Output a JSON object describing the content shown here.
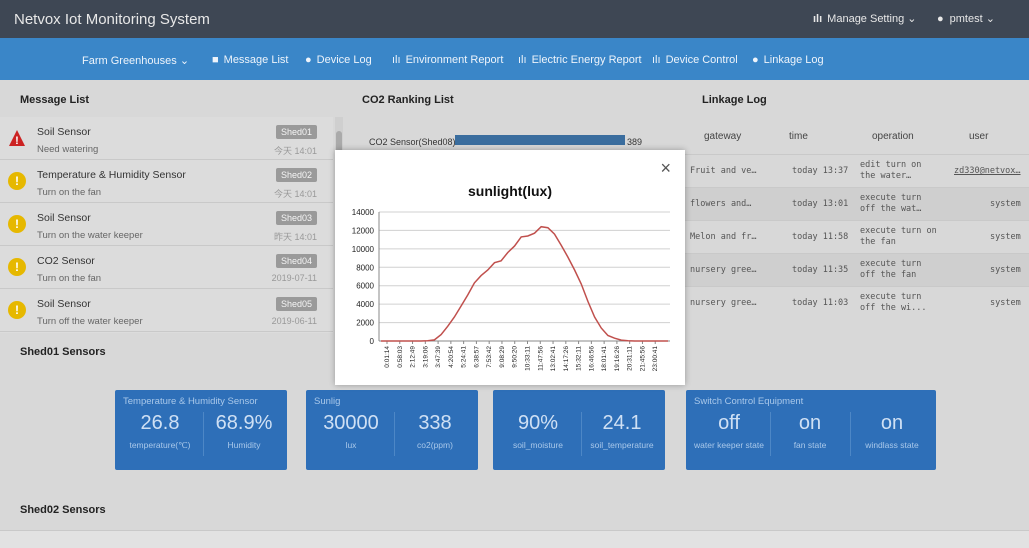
{
  "header": {
    "app_title": "Netvox Iot Monitoring System",
    "manage_setting": "Manage Setting ⌄",
    "user": "pmtest ⌄"
  },
  "nav": {
    "farm": "Farm Greenhouses ⌄",
    "message_list": "Message List",
    "device_log": "Device Log",
    "environment_report": "Environment Report",
    "electric_energy_report": "Electric Energy Report",
    "device_control": "Device Control",
    "linkage_log": "Linkage Log"
  },
  "panels": {
    "message_list": "Message List",
    "co2_ranking": "CO2 Ranking List",
    "linkage_log": "Linkage Log"
  },
  "messages": [
    {
      "title": "Soil Sensor",
      "sub": "Need watering",
      "shed": "Shed01",
      "date": "今天 14:01",
      "badge": "red"
    },
    {
      "title": "Temperature & Humidity Sensor",
      "sub": "Turn on the fan",
      "shed": "Shed02",
      "date": "今天 14:01",
      "badge": "yellow"
    },
    {
      "title": "Soil Sensor",
      "sub": "Turn on the water keeper",
      "shed": "Shed03",
      "date": "昨天 14:01",
      "badge": "yellow"
    },
    {
      "title": "CO2 Sensor",
      "sub": "Turn on the fan",
      "shed": "Shed04",
      "date": "2019-07-11",
      "badge": "yellow"
    },
    {
      "title": "Soil Sensor",
      "sub": "Turn off the water keeper",
      "shed": "Shed05",
      "date": "2019-06-11",
      "badge": "yellow"
    }
  ],
  "ranking": {
    "label": "CO2 Sensor(Shed08)",
    "value": "389"
  },
  "linkage": {
    "headers": [
      "gateway",
      "time",
      "operation",
      "user"
    ],
    "rows": [
      {
        "gateway": "Fruit and ve…",
        "time": "today 13:37",
        "op1": "edit turn on",
        "op2": "the water…",
        "user": "zd330@netvox…"
      },
      {
        "gateway": "flowers and…",
        "time": "today 13:01",
        "op1": "execute turn",
        "op2": "off the wat…",
        "user": "system"
      },
      {
        "gateway": "Melon and fr…",
        "time": "today 11:58",
        "op1": "execute turn on",
        "op2": "the fan",
        "user": "system"
      },
      {
        "gateway": "nursery gree…",
        "time": "today 11:35",
        "op1": "execute turn",
        "op2": "off the fan",
        "user": "system"
      },
      {
        "gateway": "nursery gree…",
        "time": "today 11:03",
        "op1": "execute turn",
        "op2": "off the wi...",
        "user": "system"
      }
    ]
  },
  "sections": {
    "shed01": "Shed01 Sensors",
    "shed02": "Shed02 Sensors"
  },
  "cards": {
    "th": {
      "title": "Temperature & Humidity Sensor",
      "v1": "26.8",
      "s1": "temperature(℃)",
      "v2": "68.9%",
      "s2": "Humidity"
    },
    "sun": {
      "title": "Sunlig",
      "v1": "30000",
      "s1": "lux",
      "v2": "338",
      "s2": "co2(ppm)"
    },
    "soil": {
      "v1": "90%",
      "s1": "soil_moisture",
      "v2": "24.1",
      "s2": "soil_temperature"
    },
    "switch": {
      "title": "Switch Control Equipment",
      "v1": "off",
      "s1": "water keeper state",
      "v2": "on",
      "s2": "fan state",
      "v3": "on",
      "s3": "windlass state"
    }
  },
  "modal": {
    "close": "×"
  },
  "colors": {
    "topbar": "#3e4754",
    "navbar": "#3a86c8",
    "card": "#2e6fb8",
    "line": "#c0504d",
    "alert_red": "#cc2222",
    "alert_yellow": "#e6b800"
  },
  "chart_data": {
    "type": "line",
    "title": "sunlight(lux)",
    "xlabel": "",
    "ylabel": "",
    "ylim": [
      0,
      14000
    ],
    "yticks": [
      0,
      2000,
      4000,
      6000,
      8000,
      10000,
      12000,
      14000
    ],
    "grid": true,
    "x_tick_labels": [
      "0:01:14",
      "0:58:03",
      "2:12:49",
      "3:19:06",
      "3:47:39",
      "4:20:54",
      "5:24:41",
      "6:38:57",
      "7:53:42",
      "9:08:29",
      "9:50:20",
      "10:33:11",
      "11:47:56",
      "13:02:41",
      "14:17:26",
      "15:32:11",
      "16:46:56",
      "18:01:41",
      "19:16:26",
      "20:31:11",
      "21:45:56",
      "23:00:41"
    ],
    "series": [
      {
        "values": [
          0,
          0,
          0,
          0,
          0,
          0,
          0,
          30,
          120,
          700,
          1600,
          2600,
          3800,
          5000,
          6300,
          7100,
          7700,
          8500,
          8700,
          9600,
          10300,
          11300,
          11400,
          11700,
          12400,
          12300,
          11600,
          10400,
          9100,
          7700,
          6200,
          4300,
          2600,
          1400,
          600,
          300,
          100,
          20,
          0,
          0,
          0,
          0,
          0,
          0
        ]
      }
    ]
  }
}
